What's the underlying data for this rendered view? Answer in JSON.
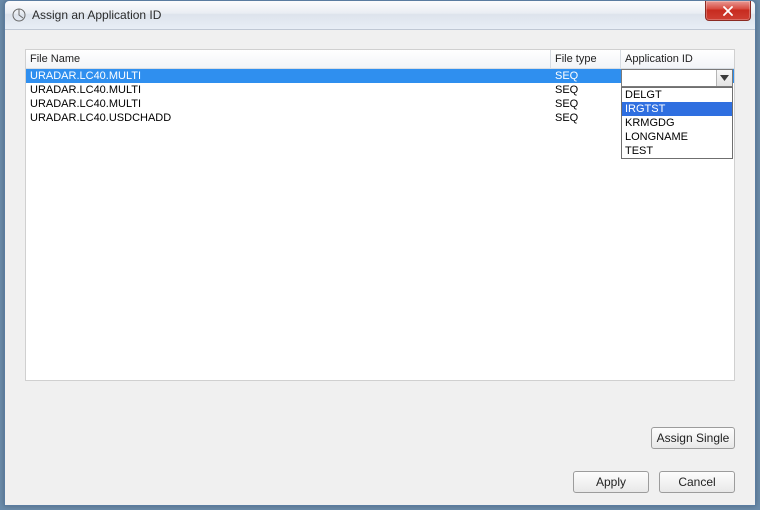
{
  "window": {
    "title": "Assign an Application ID"
  },
  "columns": {
    "file_name": "File Name",
    "file_type": "File type",
    "app_id": "Application ID"
  },
  "rows": [
    {
      "file_name": "URADAR.LC40.MULTI",
      "file_type": "SEQ",
      "app_id": "",
      "selected": true
    },
    {
      "file_name": "URADAR.LC40.MULTI",
      "file_type": "SEQ",
      "app_id": "",
      "selected": false
    },
    {
      "file_name": "URADAR.LC40.MULTI",
      "file_type": "SEQ",
      "app_id": "",
      "selected": false
    },
    {
      "file_name": "URADAR.LC40.USDCHADD",
      "file_type": "SEQ",
      "app_id": "",
      "selected": false
    }
  ],
  "combo": {
    "value": ""
  },
  "options": [
    {
      "label": "DELGT",
      "highlight": false
    },
    {
      "label": "IRGTST",
      "highlight": true
    },
    {
      "label": "KRMGDG",
      "highlight": false
    },
    {
      "label": "LONGNAME",
      "highlight": false
    },
    {
      "label": "TEST",
      "highlight": false
    }
  ],
  "buttons": {
    "assign_single": "Assign Single",
    "apply": "Apply",
    "cancel": "Cancel"
  }
}
